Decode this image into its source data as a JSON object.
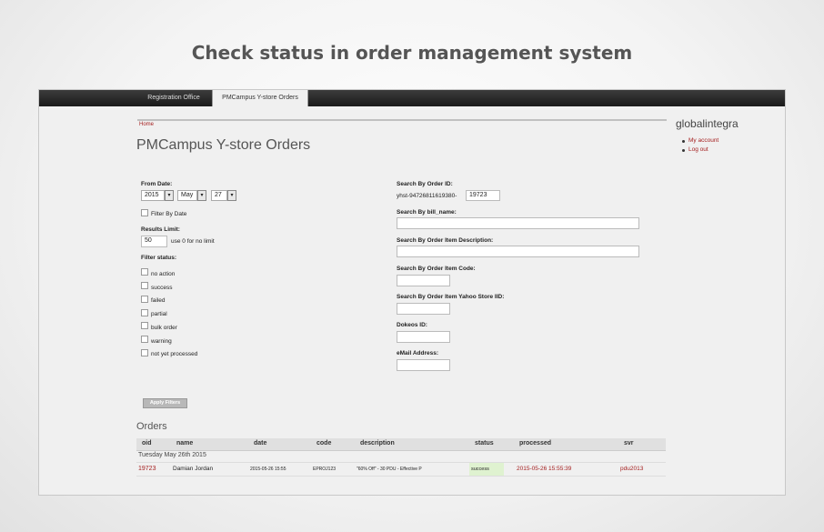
{
  "caption": "Check status in order management system",
  "nav": {
    "tabs": [
      {
        "label": "Registration Office"
      },
      {
        "label": "PMCampus Y-store Orders"
      }
    ]
  },
  "breadcrumb": "Home",
  "page_title": "PMCampus Y-store Orders",
  "filters": {
    "from_date_label": "From Date:",
    "year": "2015",
    "month": "May",
    "day": "27",
    "filter_by_date_label": "Filter By Date",
    "results_limit_label": "Results Limit:",
    "results_limit_value": "50",
    "results_limit_hint": "use 0 for no limit",
    "filter_status_label": "Filter status:",
    "statuses": [
      "no action",
      "success",
      "failed",
      "partial",
      "bulk order",
      "warning",
      "not yet processed"
    ],
    "apply_label": "Apply Filters"
  },
  "search": {
    "order_id_label": "Search By Order ID:",
    "order_id_prefix": "yhst-94726811619380-",
    "order_id_value": "19723",
    "bill_name_label": "Search By bill_name:",
    "item_desc_label": "Search By Order Item Description:",
    "item_code_label": "Search By Order Item Code:",
    "yahoo_iid_label": "Search By Order Item Yahoo Store IID:",
    "dokeos_label": "Dokeos ID:",
    "email_label": "eMail Address:"
  },
  "sidebar": {
    "title": "globalintegra",
    "links": [
      "My account",
      "Log out"
    ]
  },
  "orders": {
    "title": "Orders",
    "columns": [
      "oid",
      "name",
      "date",
      "code",
      "description",
      "status",
      "processed",
      "svr"
    ],
    "day_header": "Tuesday May 26th 2015",
    "rows": [
      {
        "oid": "19723",
        "name": "Damian Jordan",
        "date": "2015-05-26 15:55",
        "code": "EPROJ123",
        "description": "\"60% Off\" - 30 PDU - Effective P",
        "status": "success",
        "processed": "2015-05-26 15:55:39",
        "svr": "pdu2013"
      }
    ]
  },
  "colors": {
    "link": "#a52020",
    "success_bg": "#dff2d0",
    "topbar": "#1a1a1a"
  }
}
